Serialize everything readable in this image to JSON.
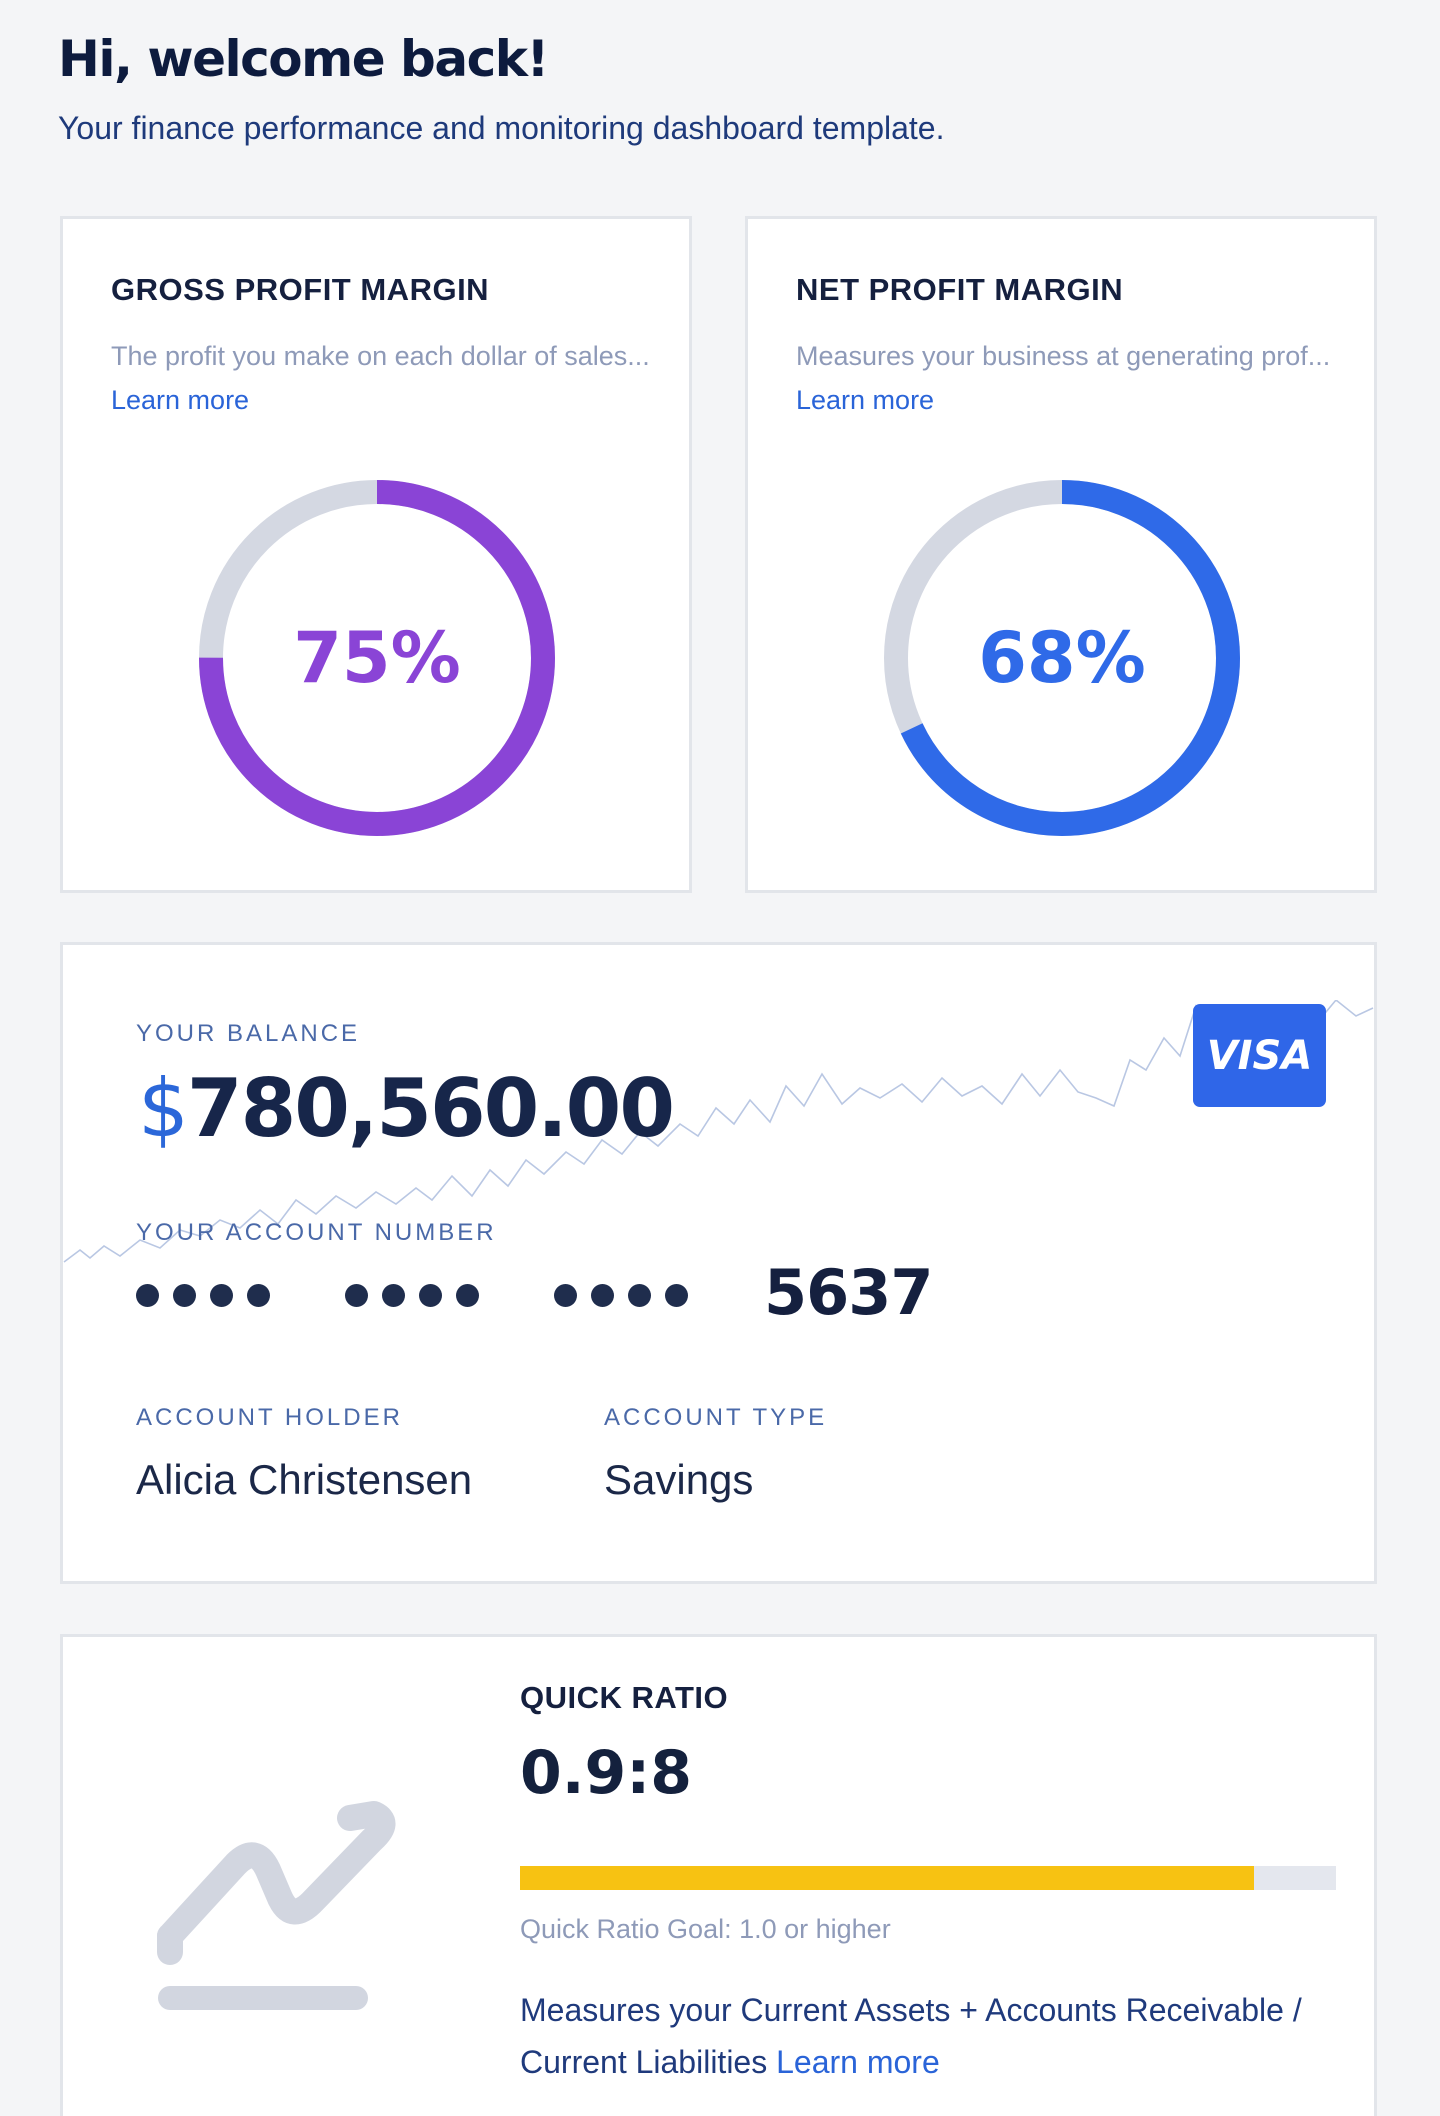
{
  "header": {
    "title": "Hi, welcome back!",
    "subtitle": "Your finance performance and monitoring dashboard template."
  },
  "gross_margin": {
    "title": "GROSS PROFIT MARGIN",
    "description": "The profit you make on each dollar of sales...",
    "learn_more": "Learn more",
    "value_label": "75%",
    "percent": 75,
    "color": "#8a44d6"
  },
  "net_margin": {
    "title": "NET PROFIT MARGIN",
    "description": "Measures your business at generating prof...",
    "learn_more": "Learn more",
    "value_label": "68%",
    "percent": 68,
    "color": "#2f6ae8"
  },
  "balance_card": {
    "balance_label": "YOUR BALANCE",
    "currency": "$",
    "balance_value": "780,560.00",
    "account_number_label": "YOUR ACCOUNT NUMBER",
    "masked_groups": 3,
    "account_last4": "5637",
    "holder_label": "ACCOUNT HOLDER",
    "holder_name": "Alicia Christensen",
    "type_label": "ACCOUNT TYPE",
    "type_value": "Savings",
    "card_brand": "VISA",
    "brand_color": "#2f66e8"
  },
  "quick_ratio": {
    "title": "QUICK RATIO",
    "value": "0.9:8",
    "progress_fraction": 0.9,
    "progress_color": "#f7c212",
    "goal_text": "Quick Ratio Goal: 1.0 or higher",
    "description": "Measures your Current Assets + Accounts Receivable / Current Liabilities",
    "learn_more": "Learn more",
    "icon": "trend-chart-icon"
  }
}
